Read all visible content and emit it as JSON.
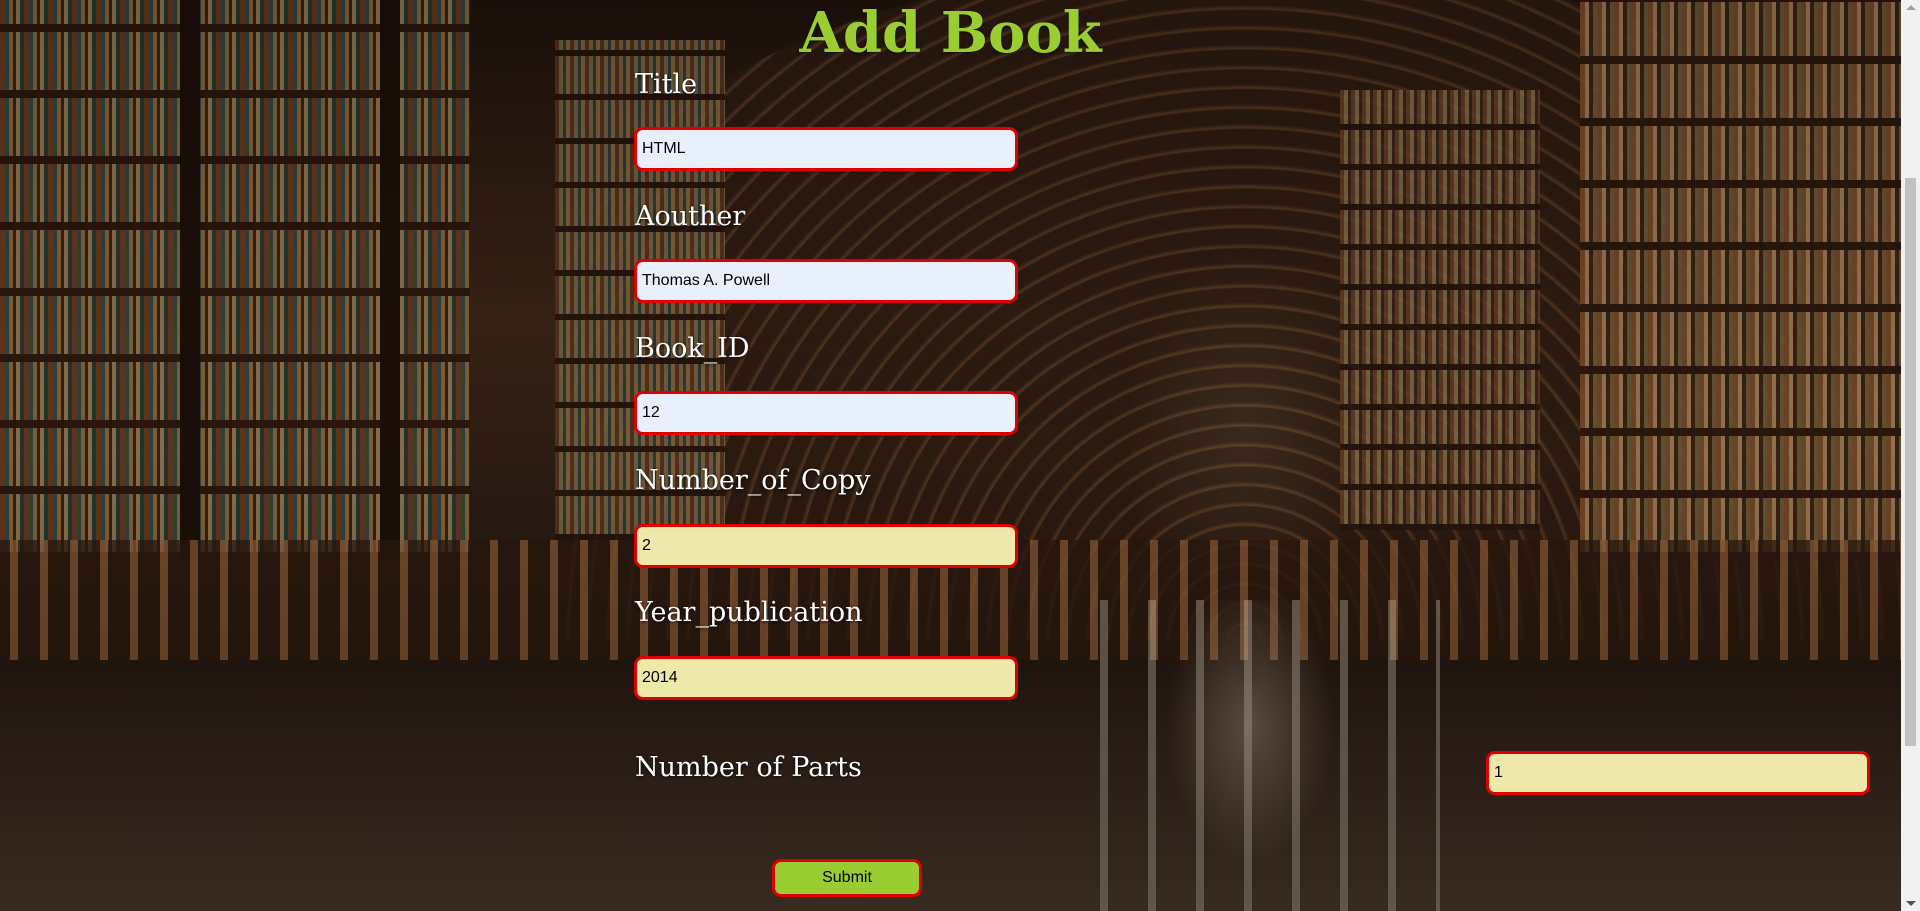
{
  "page": {
    "heading": "Add Book"
  },
  "form": {
    "title": {
      "label": "Title",
      "value": "HTML"
    },
    "author": {
      "label": "Aouther",
      "value": "Thomas A. Powell"
    },
    "book_id": {
      "label": "Book_ID",
      "value": "12"
    },
    "copies": {
      "label": "Number_of_Copy",
      "value": "2"
    },
    "year": {
      "label": "Year_publication",
      "value": "2014"
    },
    "parts": {
      "label": "Number of Parts",
      "value": "1"
    },
    "submit_label": "Submit"
  },
  "colors": {
    "heading": "#9acd32",
    "field_border": "#e00000",
    "autofill_background": "#e8f0fe",
    "field_background": "#eee8aa",
    "submit_background": "#9acd32"
  }
}
